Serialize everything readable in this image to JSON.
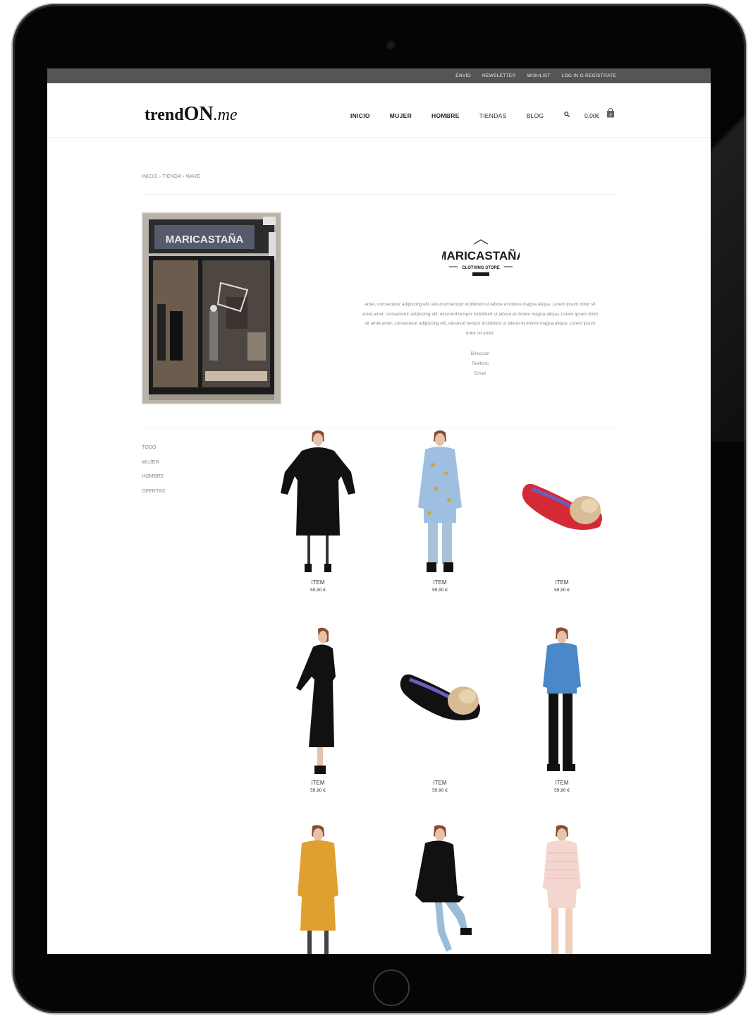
{
  "topbar": {
    "links": [
      "ENVÍO",
      "NEWSLETTER",
      "WISHLIST",
      "LOG IN O REGÍSTRATE"
    ]
  },
  "header": {
    "logo": {
      "part1": "trend",
      "part2": "ON",
      "part3": ".me"
    },
    "nav": [
      "INICIO",
      "MUJER",
      "HOMBRE",
      "TIENDAS",
      "BLOG"
    ],
    "cart_amount": "0,00€",
    "cart_count": "0"
  },
  "breadcrumb": "INICIO › TIENDA › WAVE",
  "store": {
    "logo_name": "MARICASTAÑA",
    "logo_sub": "CLOTHING STORE",
    "storefront_sign": "MARICASTAÑA",
    "description": "amet, consectetur adipiscing elit, eiusmod tempor incididunt ut labore et dolore magna aliqua. Lorem ipsum dolor sit amet.amet, consectetur adipiscing elit, eiusmod tempor incididunt ut labore et dolore magna aliqua. Lorem ipsum dolor sit amet.amet, consectetur adipiscing elit, eiusmod tempor incididunt ut labore et dolore magna aliqua. Lorem ipsum dolor sit amet.",
    "contact": {
      "address": "Dirección",
      "phone": "Teléfono",
      "email": "Email"
    }
  },
  "filters": [
    "TODO",
    "MUJER",
    "HOMBRE",
    "OFERTAS"
  ],
  "products": [
    {
      "name": "ITEM",
      "price": "59,90 €",
      "image": "black-dress"
    },
    {
      "name": "ITEM",
      "price": "59,90 €",
      "image": "blue-print-shirt-dress"
    },
    {
      "name": "ITEM",
      "price": "59,90 €",
      "image": "red-fur-loafer"
    },
    {
      "name": "ITEM",
      "price": "59,90 €",
      "image": "black-long-dress"
    },
    {
      "name": "ITEM",
      "price": "59,90 €",
      "image": "black-fur-loafer"
    },
    {
      "name": "ITEM",
      "price": "59,90 €",
      "image": "blue-cardigan"
    },
    {
      "name": "",
      "price": "",
      "image": "mustard-knit-dress"
    },
    {
      "name": "",
      "price": "",
      "image": "black-coat"
    },
    {
      "name": "",
      "price": "",
      "image": "striped-bodysuit"
    }
  ],
  "colors": {
    "topbar": "#555555",
    "accent_red": "#d42a38",
    "text": "#222222"
  }
}
